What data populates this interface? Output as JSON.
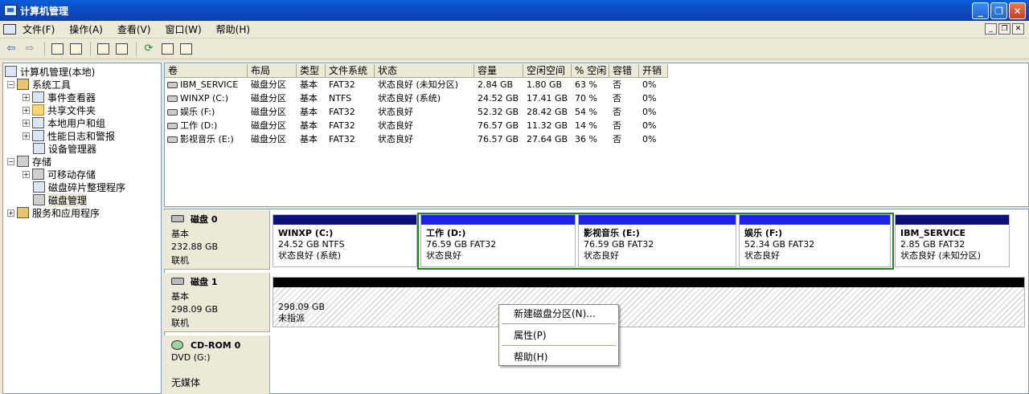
{
  "window": {
    "title": "计算机管理",
    "minimize": "_",
    "maximize": "❐",
    "close": "✕"
  },
  "menu": {
    "items": [
      "文件(F)",
      "操作(A)",
      "查看(V)",
      "窗口(W)",
      "帮助(H)"
    ],
    "mdi_buttons": [
      "_",
      "❐",
      "✕"
    ]
  },
  "toolbar": {
    "icons": [
      "back-arrow-icon",
      "forward-arrow-icon",
      "up-folder-icon",
      "show-hide-tree-icon",
      "properties-icon",
      "help-icon",
      "refresh-icon",
      "export-icon",
      "settings-icon"
    ]
  },
  "tree": {
    "root": "计算机管理(本地)",
    "system_tools": "系统工具",
    "event_viewer": "事件查看器",
    "shared_folders": "共享文件夹",
    "local_users": "本地用户和组",
    "perf_logs": "性能日志和警报",
    "device_manager": "设备管理器",
    "storage": "存储",
    "removable_storage": "可移动存储",
    "defrag": "磁盘碎片整理程序",
    "disk_mgmt": "磁盘管理",
    "services_apps": "服务和应用程序",
    "expand_minus": "−",
    "expand_plus": "+"
  },
  "volume_table": {
    "headers": [
      "卷",
      "布局",
      "类型",
      "文件系统",
      "状态",
      "容量",
      "空闲空间",
      "% 空闲",
      "容错",
      "开销"
    ],
    "rows": [
      [
        "IBM_SERVICE",
        "磁盘分区",
        "基本",
        "FAT32",
        "状态良好 (未知分区)",
        "2.84 GB",
        "1.80 GB",
        "63 %",
        "否",
        "0%"
      ],
      [
        "WINXP (C:)",
        "磁盘分区",
        "基本",
        "NTFS",
        "状态良好 (系统)",
        "24.52 GB",
        "17.41 GB",
        "70 %",
        "否",
        "0%"
      ],
      [
        "娱乐 (F:)",
        "磁盘分区",
        "基本",
        "FAT32",
        "状态良好",
        "52.32 GB",
        "28.42 GB",
        "54 %",
        "否",
        "0%"
      ],
      [
        "工作 (D:)",
        "磁盘分区",
        "基本",
        "FAT32",
        "状态良好",
        "76.57 GB",
        "11.32 GB",
        "14 %",
        "否",
        "0%"
      ],
      [
        "影视音乐 (E:)",
        "磁盘分区",
        "基本",
        "FAT32",
        "状态良好",
        "76.57 GB",
        "27.64 GB",
        "36 %",
        "否",
        "0%"
      ]
    ]
  },
  "disks": {
    "disk0": {
      "name": "磁盘 0",
      "type": "基本",
      "size": "232.88 GB",
      "status": "联机",
      "partitions": [
        {
          "name": "WINXP  (C:)",
          "size": "24.52 GB NTFS",
          "status": "状态良好 (系统)"
        },
        {
          "name": "工作  (D:)",
          "size": "76.59 GB FAT32",
          "status": "状态良好"
        },
        {
          "name": "影视音乐  (E:)",
          "size": "76.59 GB FAT32",
          "status": "状态良好"
        },
        {
          "name": "娱乐  (F:)",
          "size": "52.34 GB FAT32",
          "status": "状态良好"
        },
        {
          "name": "IBM_SERVICE",
          "size": "2.85 GB FAT32",
          "status": "状态良好 (未知分区)"
        }
      ]
    },
    "disk1": {
      "name": "磁盘 1",
      "type": "基本",
      "size": "298.09 GB",
      "status": "联机",
      "partition": {
        "size": "298.09 GB",
        "status": "未指派"
      }
    },
    "cdrom0": {
      "name": "CD-ROM 0",
      "type": "DVD (G:)",
      "status": "无媒体"
    }
  },
  "context_menu": {
    "items": [
      "新建磁盘分区(N)...",
      "属性(P)",
      "帮助(H)"
    ]
  },
  "colors": {
    "primary_partition": "#1e22e8",
    "logical_partition": "#0f0f7a",
    "unallocated": "#000000",
    "selection_border": "#178a17"
  }
}
